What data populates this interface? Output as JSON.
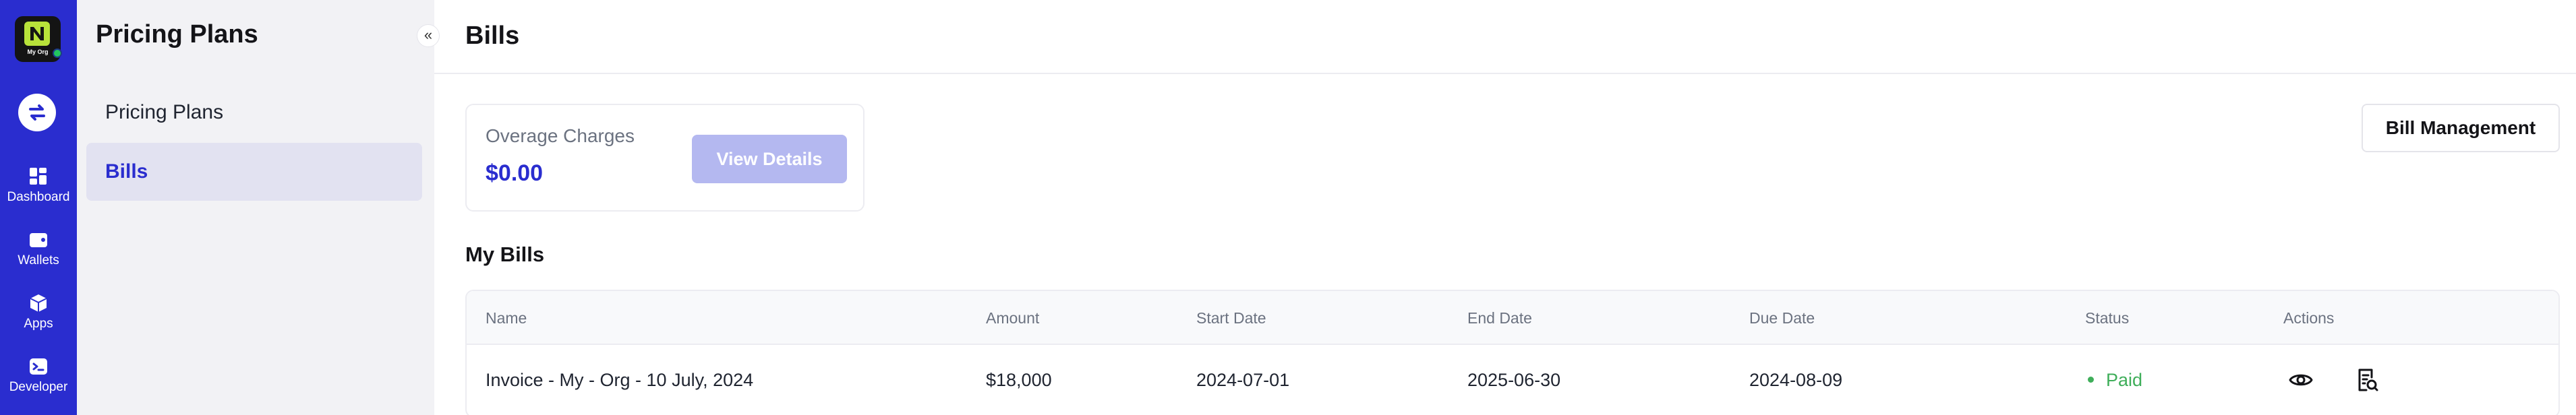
{
  "rail": {
    "org_name": "My Org",
    "items": [
      {
        "label": "Dashboard",
        "icon": "dashboard-icon"
      },
      {
        "label": "Wallets",
        "icon": "wallet-icon"
      },
      {
        "label": "Apps",
        "icon": "apps-icon"
      },
      {
        "label": "Developer",
        "icon": "terminal-icon"
      }
    ]
  },
  "subnav": {
    "title": "Pricing Plans",
    "collapse_glyph": "«",
    "items": [
      {
        "label": "Pricing Plans",
        "active": false
      },
      {
        "label": "Bills",
        "active": true
      }
    ]
  },
  "page": {
    "title": "Bills"
  },
  "overage": {
    "label": "Overage Charges",
    "value": "$0.00",
    "button": "View Details"
  },
  "bill_management_button": "Bill Management",
  "my_bills": {
    "title": "My Bills",
    "columns": [
      "Name",
      "Amount",
      "Start Date",
      "End Date",
      "Due Date",
      "Status",
      "Actions"
    ],
    "rows": [
      {
        "name": "Invoice - My - Org - 10 July, 2024",
        "amount": "$18,000",
        "start_date": "2024-07-01",
        "end_date": "2025-06-30",
        "due_date": "2024-08-09",
        "status": "Paid",
        "actions": [
          "eye-icon",
          "receipt-search-icon"
        ]
      }
    ]
  },
  "colors": {
    "brand": "#2a2dcf",
    "paid": "#3fae5a",
    "logo_accent": "#b8e23a",
    "button_disabled": "#b4b8f0"
  }
}
